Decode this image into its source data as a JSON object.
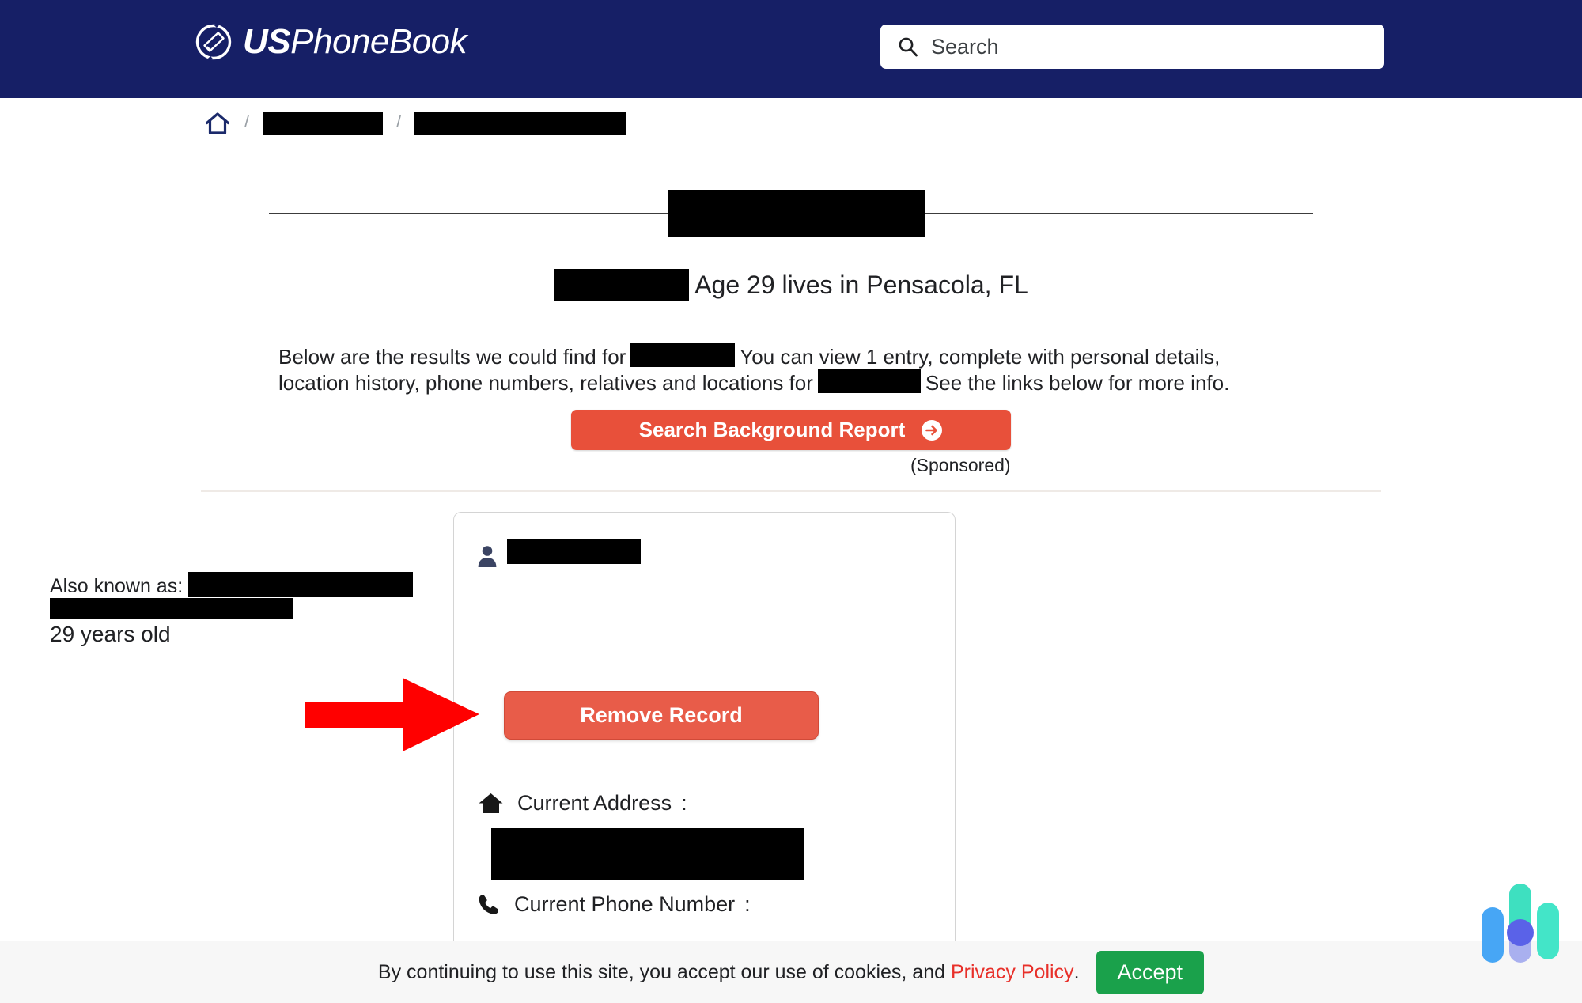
{
  "header": {
    "logo_bold": "US",
    "logo_light": "PhoneBook",
    "logo_icon": "phone-in-circle-icon",
    "search": {
      "icon": "search-icon",
      "placeholder": "Search",
      "value": ""
    }
  },
  "breadcrumb": {
    "home_icon": "home-icon",
    "separator": "/",
    "items": [
      {
        "label": "",
        "redacted": true
      },
      {
        "label": "",
        "redacted": true
      }
    ]
  },
  "title": {
    "name": "",
    "redacted": true
  },
  "subtitle": {
    "name_redacted": "",
    "text": "Age 29 lives in Pensacola, FL"
  },
  "lead": {
    "part1": "Below are the results we could find for",
    "part2": "You can view 1 entry, complete with personal details, location history, phone numbers, relatives and locations for",
    "part3": "See the links below for more info."
  },
  "cta": {
    "label": "Search Background Report",
    "icon": "arrow-right-circle-icon",
    "sponsored": "(Sponsored)",
    "color": "#E8503A"
  },
  "card": {
    "person_icon": "person-icon",
    "name_redacted": "",
    "aka_label": "Also known as:",
    "age": "29 years old",
    "remove_button": {
      "label": "Remove Record",
      "color": "#E85C49"
    },
    "pointer": {
      "icon": "red-arrow-pointer-icon",
      "color": "#FF0000"
    },
    "fields": [
      {
        "icon": "house-icon",
        "label": "Current Address",
        "colon": ":",
        "value_redacted": true
      },
      {
        "icon": "phone-icon",
        "label": "Current Phone Number",
        "colon": ":",
        "value_redacted": true
      }
    ]
  },
  "cookie_banner": {
    "text": "By continuing to use this site, you accept our use of cookies, and",
    "link": "Privacy Policy",
    "period": ".",
    "accept_label": "Accept",
    "accept_color": "#1aa14b"
  },
  "chat_widget": {
    "icon": "chat-bars-widget-icon",
    "colors": [
      "#47a6f5",
      "#3ee0c0",
      "#43e5c8",
      "#5a62e8",
      "#a9b0ef"
    ]
  }
}
